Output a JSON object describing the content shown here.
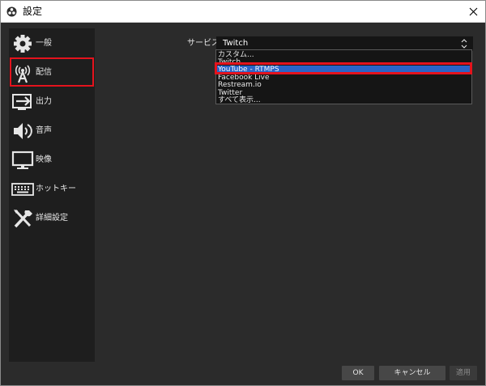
{
  "window": {
    "title": "設定"
  },
  "sidebar": {
    "items": [
      {
        "label": "一般",
        "icon": "gear-icon"
      },
      {
        "label": "配信",
        "icon": "broadcast-antenna-icon"
      },
      {
        "label": "出力",
        "icon": "output-arrow-icon"
      },
      {
        "label": "音声",
        "icon": "speaker-icon"
      },
      {
        "label": "映像",
        "icon": "monitor-icon"
      },
      {
        "label": "ホットキー",
        "icon": "keyboard-icon"
      },
      {
        "label": "詳細設定",
        "icon": "tools-icon"
      }
    ],
    "highlighted_index": 1
  },
  "stream": {
    "service_label": "サービス",
    "service_value": "Twitch",
    "dropdown_options": [
      "カスタム...",
      "Twitch",
      "YouTube - RTMPS",
      "Facebook Live",
      "Restream.io",
      "Twitter",
      "すべて表示..."
    ],
    "selected_option_index": 2
  },
  "buttons": {
    "ok": "OK",
    "cancel": "キャンセル",
    "apply": "適用"
  },
  "colors": {
    "background": "#2b2b2b",
    "sidebar": "#1e1e1e",
    "highlight": "#e4131d",
    "selection": "#2a64c8"
  }
}
